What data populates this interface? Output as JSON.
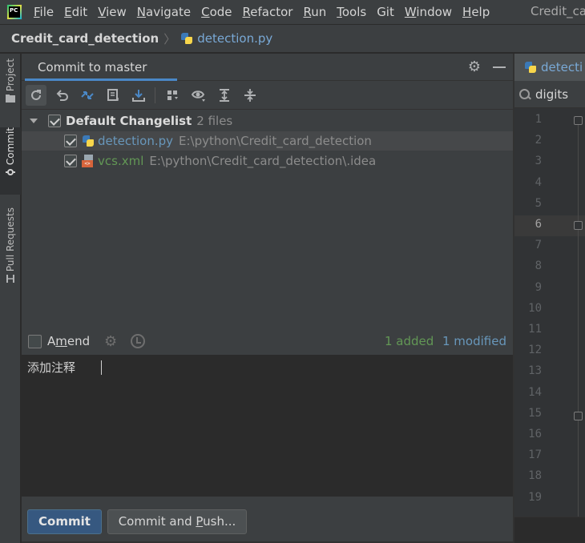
{
  "menubar": {
    "items": [
      "File",
      "Edit",
      "View",
      "Navigate",
      "Code",
      "Refactor",
      "Run",
      "Tools",
      "Git",
      "Window",
      "Help"
    ],
    "mnemonics": [
      "F",
      "E",
      "V",
      "N",
      "C",
      "R",
      "R",
      "T",
      "",
      "W",
      "H"
    ],
    "window_title": "Credit_ca"
  },
  "breadcrumb": {
    "project": "Credit_card_detection",
    "file": "detection.py"
  },
  "left_tools": [
    "Project",
    "Commit",
    "Pull Requests"
  ],
  "commit_panel": {
    "title": "Commit to master",
    "changelist": {
      "name": "Default Changelist",
      "count": "2 files"
    },
    "files": [
      {
        "name": "detection.py",
        "path": "E:\\python\\Credit_card_detection",
        "status": "modified",
        "checked": true
      },
      {
        "name": "vcs.xml",
        "path": "E:\\python\\Credit_card_detection\\.idea",
        "status": "added",
        "checked": true
      }
    ],
    "amend_label_pre": "A",
    "amend_label_mn": "m",
    "amend_label_post": "end",
    "added": "1 added",
    "modified": "1 modified",
    "message": "添加注释",
    "commit_button": "Commit",
    "commit_push_pre": "Commit and ",
    "commit_push_mn": "P",
    "commit_push_post": "ush..."
  },
  "editor": {
    "tab_label": "detecti",
    "search_value": "digits",
    "line_numbers": [
      "1",
      "2",
      "3",
      "4",
      "5",
      "6",
      "7",
      "8",
      "9",
      "10",
      "11",
      "12",
      "13",
      "14",
      "15",
      "16",
      "17",
      "18",
      "19"
    ],
    "current_line": "6"
  },
  "colors": {
    "accent": "#4a88c7",
    "added": "#629755",
    "modified": "#6897bb",
    "commit_button": "#365880"
  }
}
